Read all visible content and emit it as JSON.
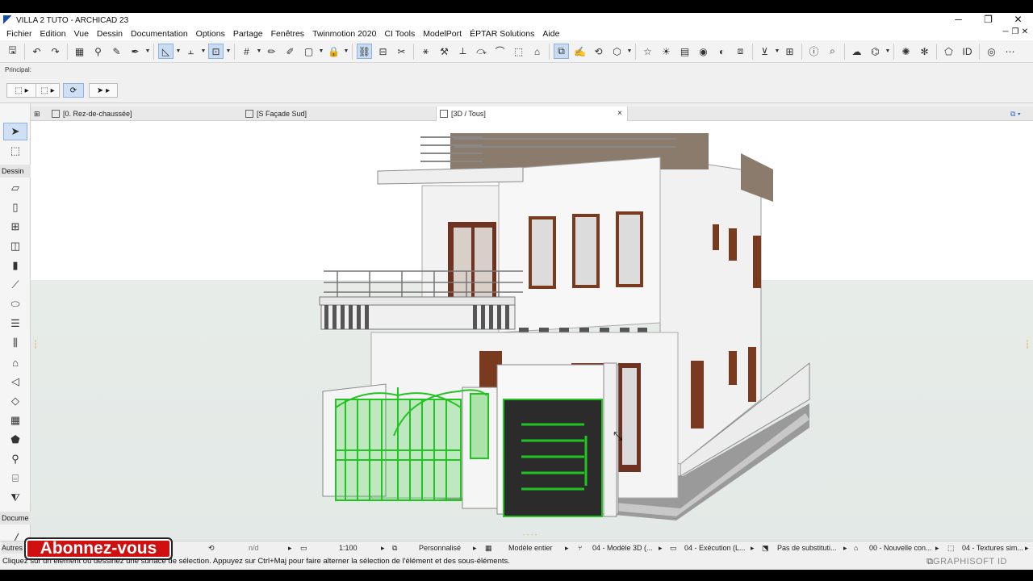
{
  "window": {
    "title": "VILLA 2 TUTO - ARCHICAD 23",
    "min": "─",
    "restore": "❐",
    "close": "✕"
  },
  "menu": [
    "Fichier",
    "Edition",
    "Vue",
    "Dessin",
    "Documentation",
    "Options",
    "Partage",
    "Fenêtres",
    "Twinmotion 2020",
    "CI Tools",
    "ModelPort",
    "ÉPTAR Solutions",
    "Aide"
  ],
  "infobox": {
    "label": "Principal:"
  },
  "toolbox": {
    "section_dessin": "Dessin",
    "section_docume": "Docume",
    "section_autres": "Autres"
  },
  "tabs": [
    {
      "label": "[0. Rez-de-chaussée]"
    },
    {
      "label": "[S Façade Sud]"
    },
    {
      "label": "[3D / Tous]",
      "close": "×"
    }
  ],
  "viewstatus": {
    "nd": "n/d",
    "scale": "1:100",
    "personnalise": "Personnalisé",
    "modele": "Modèle entier",
    "modele3d": "04 - Modèle 3D (...",
    "execution": "04 - Exécution (L...",
    "substitution": "Pas de substituti...",
    "nouvelle": "00 - Nouvelle con...",
    "textures": "04 - Textures sim..."
  },
  "status_message": "Cliquez sur un élément ou dessinez une surface de sélection. Appuyez sur Ctrl+Maj pour faire alterner la sélection de l'élément et des sous-éléments.",
  "brand": "GRAPHISOFT ID",
  "overlay_badge": "Abonnez-vous",
  "colors": {
    "selection_green": "#22c422",
    "accent_blue": "#c9dcf2",
    "badge_red": "#d01010"
  }
}
